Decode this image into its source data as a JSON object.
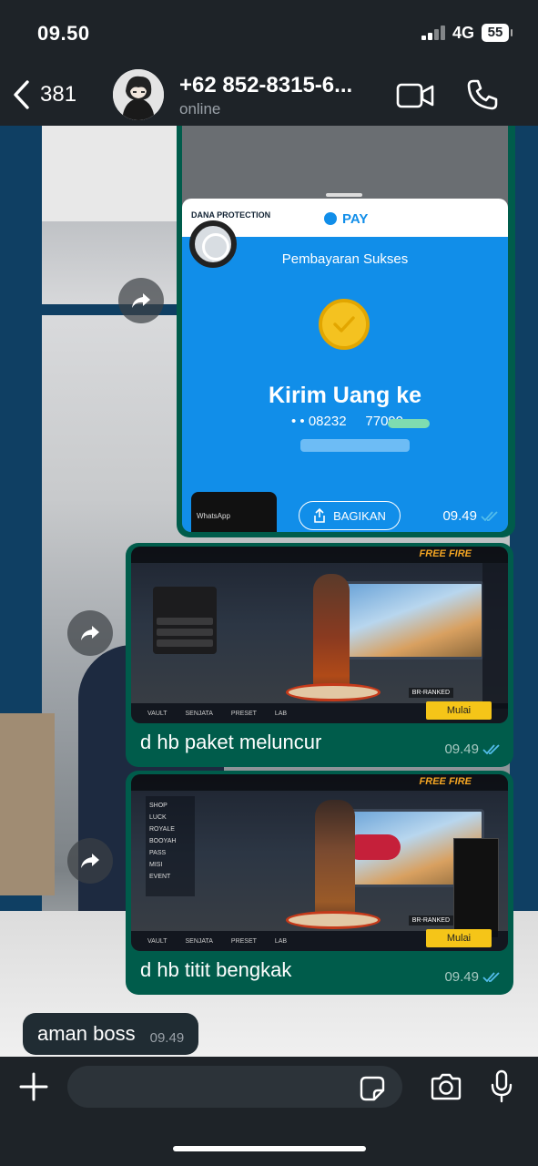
{
  "status": {
    "time": "09.50",
    "network": "4G",
    "battery": "55"
  },
  "header": {
    "unread_count": "381",
    "contact_name": "+62 852-8315-6...",
    "presence": "online"
  },
  "messages": [
    {
      "type": "forwarded-image",
      "screenshot": {
        "protection_label": "DANA PROTECTION",
        "pay_label": "PAY",
        "status_text": "Pembayaran Sukses",
        "headline": "Kirim Uang ke",
        "account": "• • 08232     77099",
        "share_button": "BAGIKAN",
        "mini_phone_label": "WhatsApp"
      },
      "time": "09.49"
    },
    {
      "type": "forwarded-image",
      "game": {
        "logo": "FREE FIRE",
        "start_button": "Mulai",
        "ranked_label": "BR-RANKED",
        "menu": [
          "VAULT",
          "SENJATA",
          "PRESET",
          "LAB"
        ]
      },
      "caption": "d hb paket meluncur",
      "time": "09.49"
    },
    {
      "type": "forwarded-image",
      "game": {
        "logo": "FREE FIRE",
        "start_button": "Mulai",
        "ranked_label": "BR-RANKED",
        "menu": [
          "VAULT",
          "SENJATA",
          "PRESET",
          "LAB"
        ],
        "side_menu": [
          "SHOP",
          "LUCK ROYALE",
          "BOOYAH PASS",
          "MISI",
          "EVENT"
        ]
      },
      "caption": "d hb titit bengkak",
      "time": "09.49"
    },
    {
      "type": "incoming-text",
      "text": "aman boss",
      "time": "09.49"
    }
  ],
  "icons": [
    "back-chevron-icon",
    "video-call-icon",
    "phone-call-icon",
    "forward-icon",
    "double-check-icon",
    "plus-icon",
    "sticker-icon",
    "camera-icon",
    "mic-icon"
  ],
  "colors": {
    "outgoing_bubble": "#005c4b",
    "incoming_bubble": "#202c33",
    "bar": "#1e2328",
    "read_ticks": "#53bdeb",
    "dana_blue": "#118ee9"
  }
}
